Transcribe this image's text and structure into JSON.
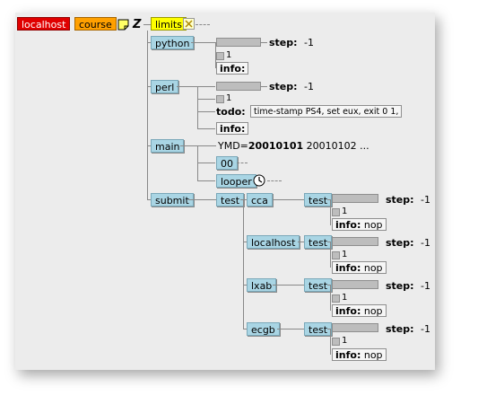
{
  "header": {
    "server": "localhost",
    "suite": "course",
    "z_label": "Z",
    "limits": "limits"
  },
  "tree": {
    "python": "python",
    "perl": "perl",
    "main": "main",
    "submit": "submit",
    "step_label": "step:",
    "step_value": "-1",
    "one": "1",
    "info_label": "info:",
    "todo_label": "todo:",
    "todo_value": "time-stamp PS4, set eux, exit 0 1,",
    "ymd_prefix": "YMD=",
    "ymd_bold": "20010101",
    "ymd_rest": "20010102 ...",
    "n00": "00",
    "looper": "looper",
    "test": "test",
    "cca": "cca",
    "localhost2": "localhost",
    "lxab": "lxab",
    "ecgb": "ecgb",
    "nop": "nop"
  },
  "colors": {
    "server": "#e00000",
    "suite": "#ffa000",
    "limits": "#ffff00",
    "node": "#a9d5e4",
    "background": "#ececec"
  }
}
